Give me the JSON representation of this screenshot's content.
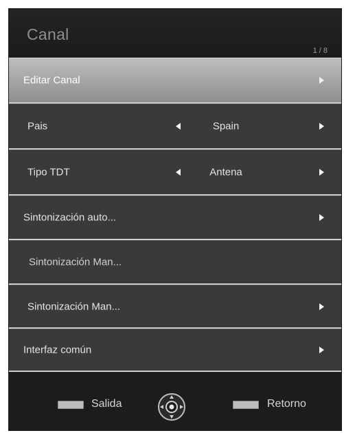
{
  "menu": {
    "title": "Canal",
    "page_indicator": "1 / 8"
  },
  "rows": [
    {
      "label": "Editar Canal",
      "value": "",
      "has_left_arrow": false,
      "has_right_arrow": true,
      "selected": true
    },
    {
      "label": "Pais",
      "value": "Spain",
      "has_left_arrow": true,
      "has_right_arrow": true,
      "selected": false
    },
    {
      "label": "Tipo TDT",
      "value": "Antena",
      "has_left_arrow": true,
      "has_right_arrow": true,
      "selected": false
    },
    {
      "label": "Sintonización auto...",
      "value": "",
      "has_left_arrow": false,
      "has_right_arrow": true,
      "selected": false
    },
    {
      "label": "Sintonización Man...",
      "value": "",
      "has_left_arrow": false,
      "has_right_arrow": false,
      "selected": false
    },
    {
      "label": "Sintonización Man...",
      "value": "",
      "has_left_arrow": false,
      "has_right_arrow": true,
      "selected": false
    },
    {
      "label": "Interfaz común",
      "value": "",
      "has_left_arrow": false,
      "has_right_arrow": true,
      "selected": false
    }
  ],
  "footer": {
    "exit_label": "Salida",
    "dpad_icon": "dpad-ok-icon",
    "return_label": "Retorno"
  },
  "colors": {
    "menu_background": "#202020",
    "row_background": "#3a3a3a",
    "row_selected": "#a8a8a8",
    "row_separator": "#cfcfcf",
    "text": "#e3e3e3"
  }
}
